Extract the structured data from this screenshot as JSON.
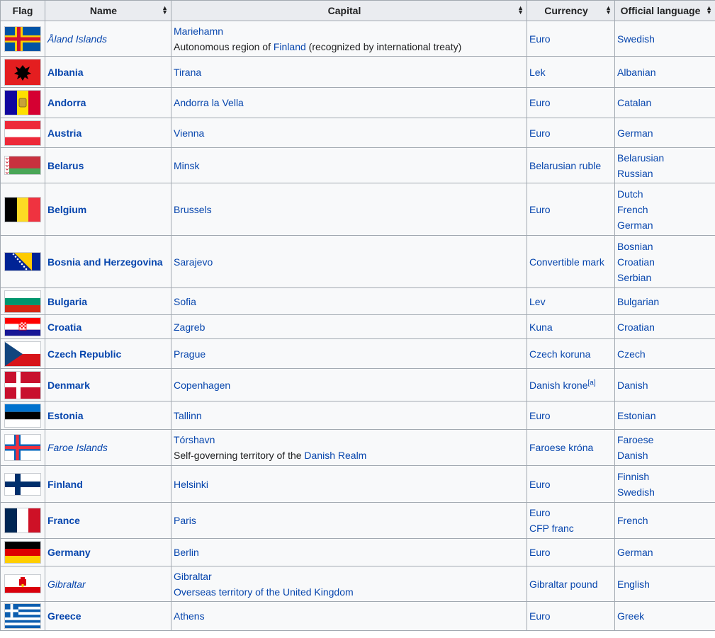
{
  "headers": {
    "flag": "Flag",
    "name": "Name",
    "capital": "Capital",
    "currency": "Currency",
    "language": "Official language"
  },
  "rows": [
    {
      "flag": "aland-flag",
      "name": "Åland Islands",
      "territory": true,
      "capital": [
        "Mariehamn"
      ],
      "note_prefix": "Autonomous region of ",
      "note_link": "Finland",
      "note_suffix": " (recognized by international treaty)",
      "currency": [
        "Euro"
      ],
      "languages": [
        "Swedish"
      ]
    },
    {
      "flag": "albania-flag",
      "name": "Albania",
      "territory": false,
      "capital": [
        "Tirana"
      ],
      "currency": [
        "Lek"
      ],
      "languages": [
        "Albanian"
      ]
    },
    {
      "flag": "andorra-flag",
      "name": "Andorra",
      "territory": false,
      "capital": [
        "Andorra la Vella"
      ],
      "currency": [
        "Euro"
      ],
      "languages": [
        "Catalan"
      ]
    },
    {
      "flag": "austria-flag",
      "name": "Austria",
      "territory": false,
      "capital": [
        "Vienna"
      ],
      "currency": [
        "Euro"
      ],
      "languages": [
        "German"
      ]
    },
    {
      "flag": "belarus-flag",
      "name": "Belarus",
      "territory": false,
      "capital": [
        "Minsk"
      ],
      "currency": [
        "Belarusian ruble"
      ],
      "languages": [
        "Belarusian",
        "Russian"
      ]
    },
    {
      "flag": "belgium-flag",
      "name": "Belgium",
      "territory": false,
      "capital": [
        "Brussels"
      ],
      "currency": [
        "Euro"
      ],
      "languages": [
        "Dutch",
        "French",
        "German"
      ]
    },
    {
      "flag": "bosnia-flag",
      "name": "Bosnia and Herzegovina",
      "territory": false,
      "capital": [
        "Sarajevo"
      ],
      "currency": [
        "Convertible mark"
      ],
      "languages": [
        "Bosnian",
        "Croatian",
        "Serbian"
      ]
    },
    {
      "flag": "bulgaria-flag",
      "name": "Bulgaria",
      "territory": false,
      "capital": [
        "Sofia"
      ],
      "currency": [
        "Lev"
      ],
      "languages": [
        "Bulgarian"
      ]
    },
    {
      "flag": "croatia-flag",
      "name": "Croatia",
      "territory": false,
      "capital": [
        "Zagreb"
      ],
      "currency": [
        "Kuna"
      ],
      "languages": [
        "Croatian"
      ]
    },
    {
      "flag": "czech-flag",
      "name": "Czech Republic",
      "territory": false,
      "capital": [
        "Prague"
      ],
      "currency": [
        "Czech koruna"
      ],
      "languages": [
        "Czech"
      ]
    },
    {
      "flag": "denmark-flag",
      "name": "Denmark",
      "territory": false,
      "capital": [
        "Copenhagen"
      ],
      "currency": [
        "Danish krone"
      ],
      "currency_note": "[a]",
      "languages": [
        "Danish"
      ]
    },
    {
      "flag": "estonia-flag",
      "name": "Estonia",
      "territory": false,
      "capital": [
        "Tallinn"
      ],
      "currency": [
        "Euro"
      ],
      "languages": [
        "Estonian"
      ]
    },
    {
      "flag": "faroe-flag",
      "name": "Faroe Islands",
      "territory": true,
      "capital": [
        "Tórshavn"
      ],
      "note_prefix": "Self-governing territory of the ",
      "note_link": "Danish Realm",
      "note_suffix": "",
      "currency": [
        "Faroese króna"
      ],
      "languages": [
        "Faroese",
        "Danish"
      ]
    },
    {
      "flag": "finland-flag",
      "name": "Finland",
      "territory": false,
      "capital": [
        "Helsinki"
      ],
      "currency": [
        "Euro"
      ],
      "languages": [
        "Finnish",
        "Swedish"
      ]
    },
    {
      "flag": "france-flag",
      "name": "France",
      "territory": false,
      "capital": [
        "Paris"
      ],
      "currency": [
        "Euro",
        "CFP franc"
      ],
      "languages": [
        "French"
      ]
    },
    {
      "flag": "germany-flag",
      "name": "Germany",
      "territory": false,
      "capital": [
        "Berlin"
      ],
      "currency": [
        "Euro"
      ],
      "languages": [
        "German"
      ]
    },
    {
      "flag": "gibraltar-flag",
      "name": "Gibraltar",
      "territory": true,
      "capital": [
        "Gibraltar",
        "Overseas territory of the United Kingdom"
      ],
      "currency": [
        "Gibraltar pound"
      ],
      "languages": [
        "English"
      ]
    },
    {
      "flag": "greece-flag",
      "name": "Greece",
      "territory": false,
      "capital": [
        "Athens"
      ],
      "currency": [
        "Euro"
      ],
      "languages": [
        "Greek"
      ]
    }
  ],
  "colors": {
    "link": "#0645ad",
    "header_bg": "#eaecf0",
    "border": "#a2a9b1",
    "cell_bg": "#f8f9fa"
  }
}
